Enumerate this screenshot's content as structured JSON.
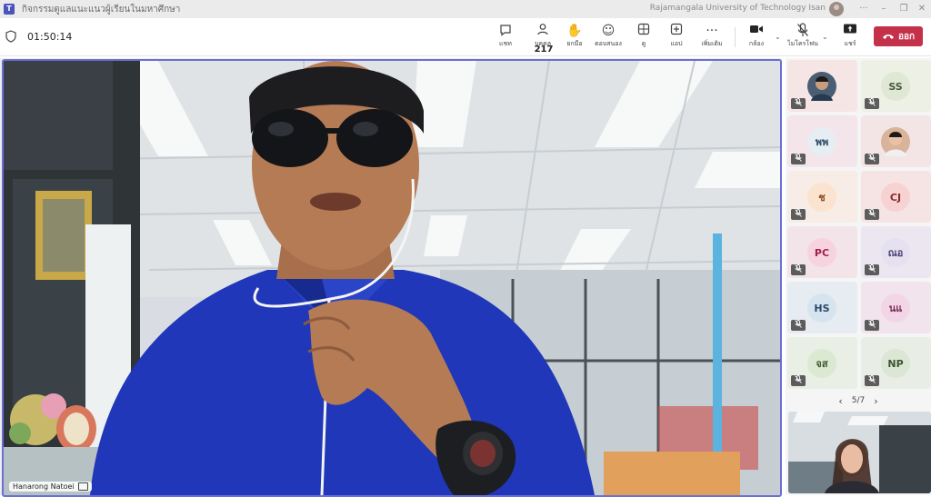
{
  "window": {
    "title": "กิจกรรมดูแลแนะแนวผู้เรียนในมหาศึกษา",
    "org_name": "Rajamangala University of Technology Isan"
  },
  "meeting": {
    "elapsed": "01:50:14",
    "toolbar": {
      "chat_label": "แชท",
      "people_label": "บุคคล",
      "people_count": "217",
      "raise_label": "ยกมือ",
      "react_label": "ตอบสนอง",
      "view_label": "ดู",
      "apps_label": "แอป",
      "more_label": "เพิ่มเติม",
      "camera_label": "กล้อง",
      "mic_label": "ไมโครโฟน",
      "share_label": "แชร์",
      "leave_label": "ออก"
    },
    "speaker_name": "Hanarong Natoei"
  },
  "gallery": {
    "tiles": [
      {
        "initials": "",
        "photo": true,
        "bg": "#f6e5e5"
      },
      {
        "initials": "SS",
        "bg": "#edf0e5",
        "avatar_bg": "#dfe7d5",
        "fg": "#4a5a3a"
      },
      {
        "initials": "พพ",
        "bg": "#f3e5ea",
        "avatar_bg": "#e6eef4",
        "fg": "#2d4a63"
      },
      {
        "initials": "",
        "photo": true,
        "bg": "#f3e5e5"
      },
      {
        "initials": "ช",
        "bg": "#f7ece6",
        "avatar_bg": "#fbe3cf",
        "fg": "#8a4a1c"
      },
      {
        "initials": "CJ",
        "bg": "#f6e4e4",
        "avatar_bg": "#f6d2d2",
        "fg": "#8a2a2a"
      },
      {
        "initials": "PC",
        "bg": "#f3e4e9",
        "avatar_bg": "#f7d3df",
        "fg": "#a02050"
      },
      {
        "initials": "ณอ",
        "bg": "#ece6f1",
        "avatar_bg": "#e6e1f1",
        "fg": "#4b3f74"
      },
      {
        "initials": "HS",
        "bg": "#e6ecf2",
        "avatar_bg": "#d6e4f0",
        "fg": "#2a4a6a"
      },
      {
        "initials": "นแ",
        "bg": "#f1e4ec",
        "avatar_bg": "#f3d6e6",
        "fg": "#7a2a55"
      },
      {
        "initials": "จส",
        "bg": "#e9efe4",
        "avatar_bg": "#dce9d2",
        "fg": "#3a5a2a"
      },
      {
        "initials": "NP",
        "bg": "#e8ede5",
        "avatar_bg": "#dbe6d4",
        "fg": "#3a5530"
      }
    ],
    "page": "5/7"
  },
  "colors": {
    "accent": "#6b6fd4",
    "leave": "#c4314b"
  }
}
